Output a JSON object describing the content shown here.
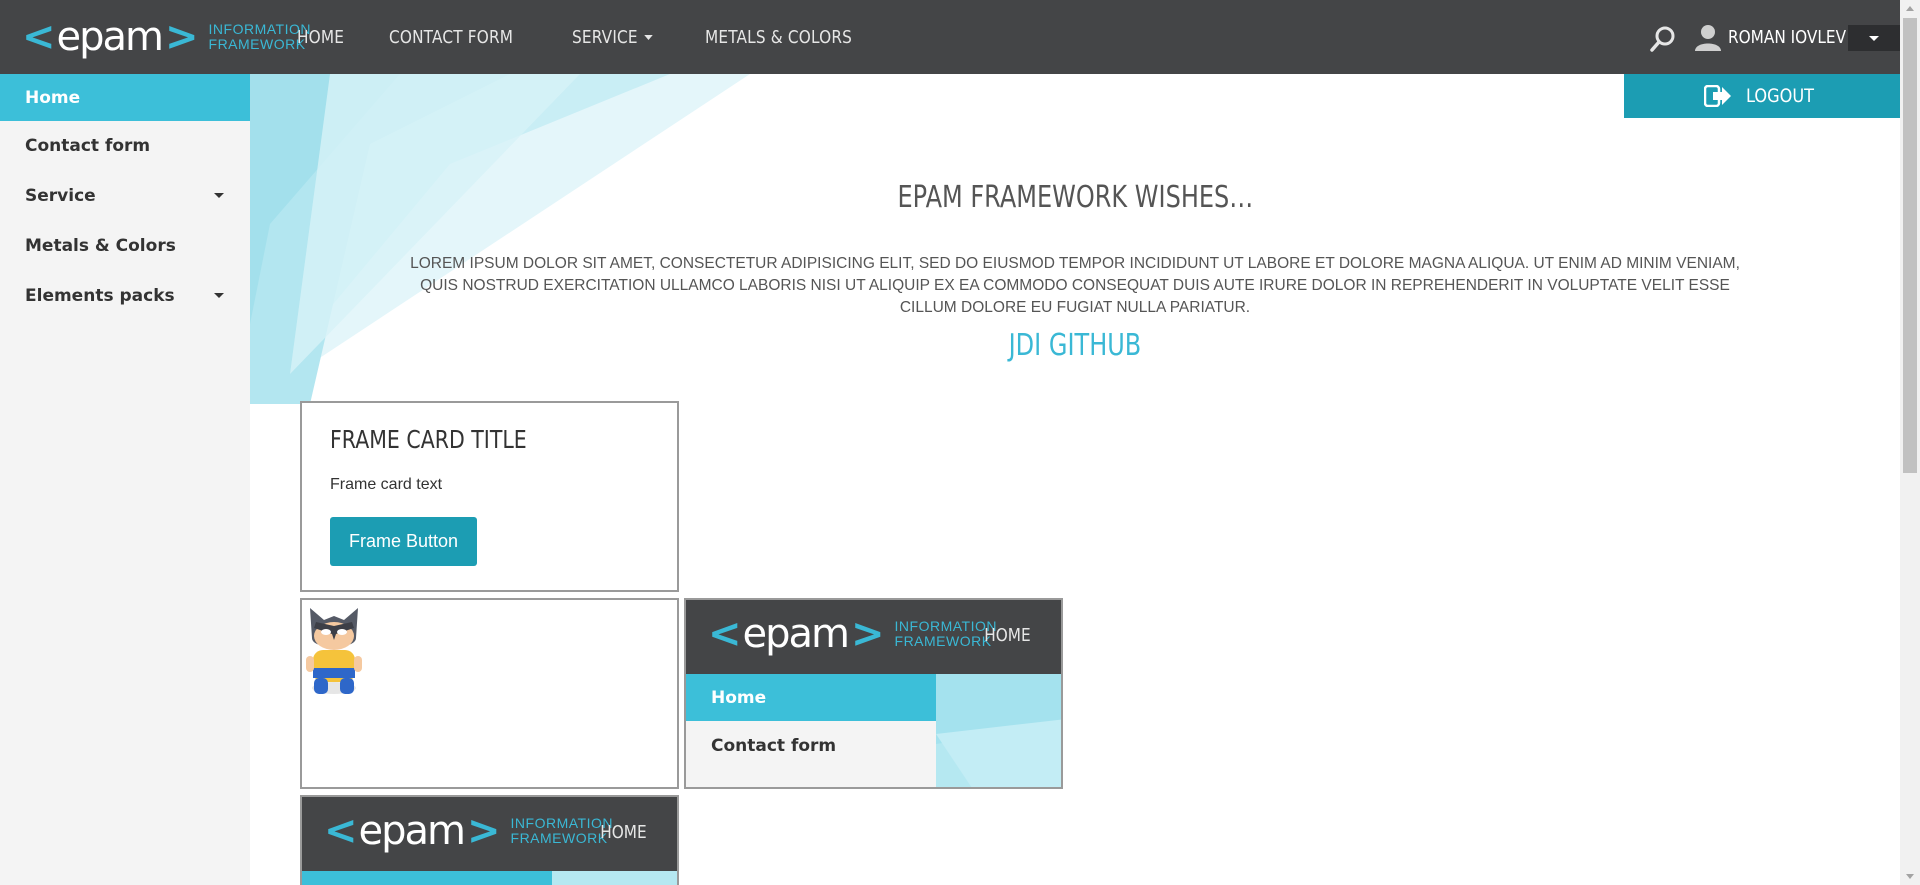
{
  "brand": {
    "logo_word": "epam",
    "logo_left": "<",
    "logo_right": ">",
    "sub_line1": "INFORMATION",
    "sub_line2": "FRAMEWORK"
  },
  "top_nav": {
    "home": "HOME",
    "contact": "CONTACT FORM",
    "service": "SERVICE",
    "metals": "METALS & COLORS"
  },
  "user": {
    "name": "ROMAN IOVLEV",
    "icon": "user-icon"
  },
  "search_icon": "search-icon",
  "logout": {
    "label": "LOGOUT",
    "icon": "logout-icon"
  },
  "sidebar": {
    "items": [
      {
        "label": "Home"
      },
      {
        "label": "Contact form"
      },
      {
        "label": "Service"
      },
      {
        "label": "Metals & Colors"
      },
      {
        "label": "Elements packs"
      }
    ]
  },
  "main": {
    "title": "EPAM FRAMEWORK WISHES…",
    "text": "LOREM IPSUM DOLOR SIT AMET, CONSECTETUR ADIPISICING ELIT, SED DO EIUSMOD TEMPOR INCIDIDUNT UT LABORE ET DOLORE MAGNA ALIQUA. UT ENIM AD MINIM VENIAM, QUIS NOSTRUD EXERCITATION ULLAMCO LABORIS NISI UT ALIQUIP EX EA COMMODO CONSEQUAT DUIS AUTE IRURE DOLOR IN REPREHENDERIT IN VOLUPTATE VELIT ESSE CILLUM DOLORE EU FUGIAT NULLA PARIATUR.",
    "link": "JDI GITHUB"
  },
  "frame_card": {
    "title": "FRAME CARD TITLE",
    "text": "Frame card text",
    "button": "Frame Button"
  },
  "mini_frame": {
    "home": "HOME",
    "side_home": "Home",
    "side_contact": "Contact form"
  },
  "colors": {
    "header": "#444547",
    "accent": "#3ab8d5",
    "active": "#3cbfd9",
    "button": "#1c9db3",
    "sidebar": "#f4f4f4"
  }
}
